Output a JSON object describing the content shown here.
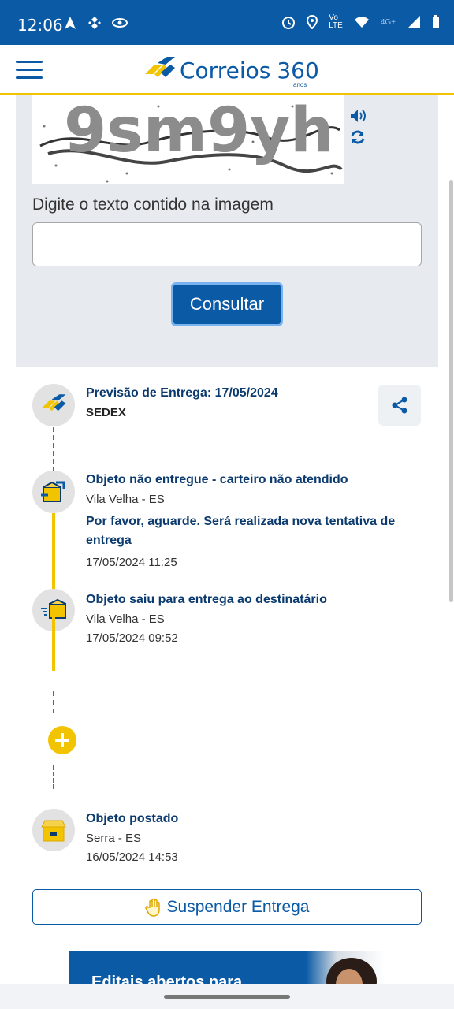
{
  "status_bar": {
    "time": "12:06",
    "left_icons": [
      "navigation-icon",
      "binance-icon",
      "visibility-icon"
    ],
    "right_icons": [
      "alarm-icon",
      "location-icon",
      "volte-icon",
      "wifi-icon",
      "signal-icon",
      "battery-icon"
    ],
    "network": "4G+"
  },
  "header": {
    "brand": "Correios",
    "anniversary": "360",
    "anniversary_sub": "anos",
    "accent_color": "#0b5aa6",
    "yellow": "#f2c400"
  },
  "captcha": {
    "image_text": "9sm9yh",
    "label": "Digite o texto contido na imagem",
    "input_value": "",
    "button": "Consultar"
  },
  "forecast": {
    "title": "Previsão de Entrega: 17/05/2024",
    "service": "SEDEX"
  },
  "events": [
    {
      "title": "Objeto não entregue - carteiro não atendido",
      "location": "Vila Velha - ES",
      "note": "Por favor, aguarde. Será realizada nova tentativa de entrega",
      "datetime": "17/05/2024 11:25"
    },
    {
      "title": "Objeto saiu para entrega ao destinatário",
      "location": "Vila Velha - ES",
      "datetime": "17/05/2024 09:52"
    },
    {
      "title": "Objeto postado",
      "location": "Serra - ES",
      "datetime": "16/05/2024 14:53"
    }
  ],
  "suspend_button": "Suspender Entrega",
  "banner_text": "Editais abertos para"
}
